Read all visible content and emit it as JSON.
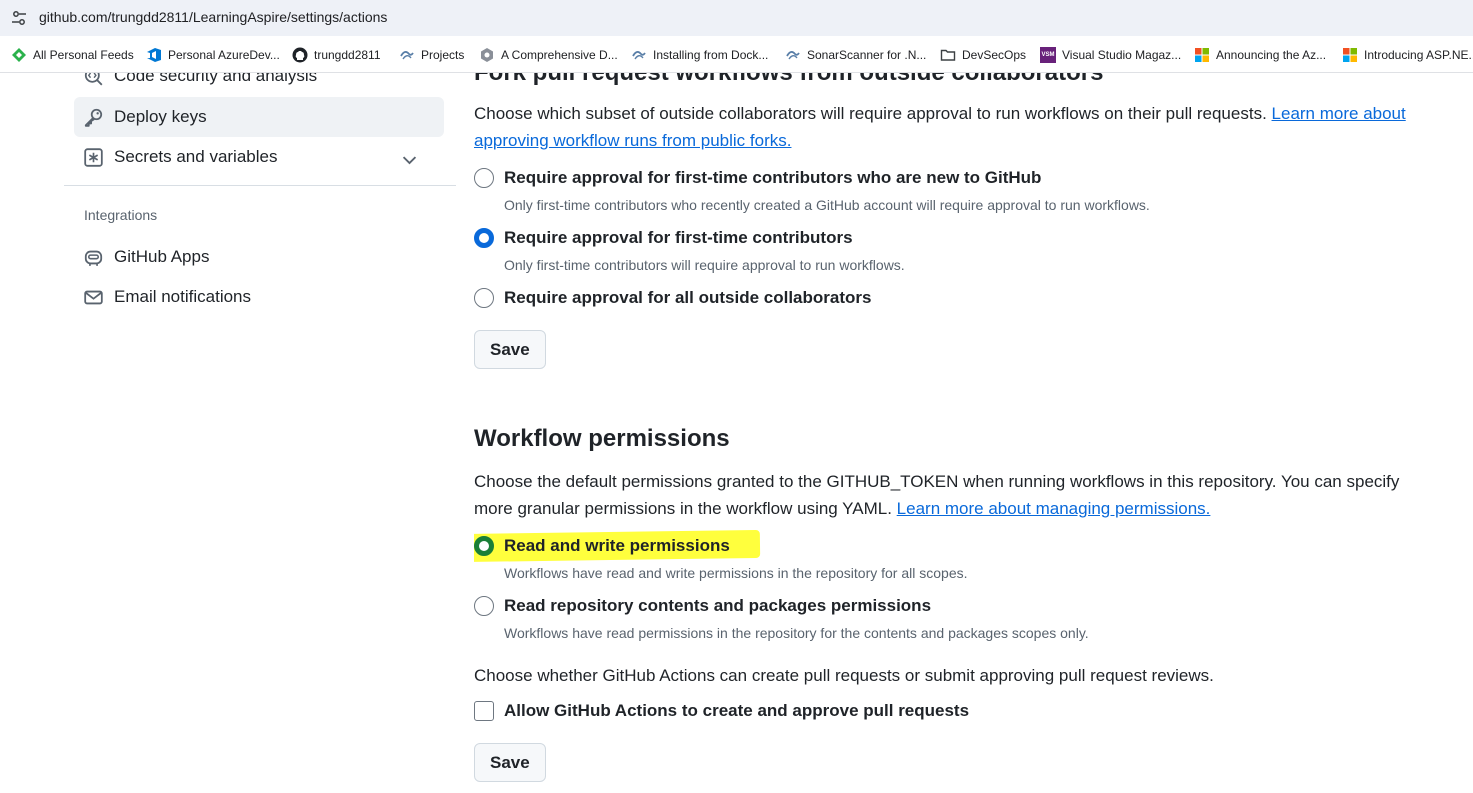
{
  "browser": {
    "url": "github.com/trungdd2811/LearningAspire/settings/actions",
    "bookmarks": [
      {
        "label": "All Personal Feeds",
        "icon": "feedly-icon"
      },
      {
        "label": "Personal AzureDev...",
        "icon": "azure-devops-icon"
      },
      {
        "label": "trungdd2811",
        "icon": "github-icon"
      },
      {
        "label": "Projects",
        "icon": "tilde-icon"
      },
      {
        "label": "A Comprehensive D...",
        "icon": "hexagon-icon"
      },
      {
        "label": "Installing from Dock...",
        "icon": "tilde-icon"
      },
      {
        "label": "SonarScanner for .N...",
        "icon": "tilde-icon"
      },
      {
        "label": "DevSecOps",
        "icon": "folder-icon"
      },
      {
        "label": "Visual Studio Magaz...",
        "icon": "vsm-icon",
        "badge": "VSM"
      },
      {
        "label": "Announcing the Az...",
        "icon": "microsoft-icon"
      },
      {
        "label": "Introducing ASP.NE...",
        "icon": "microsoft-icon"
      }
    ]
  },
  "sidebar": {
    "items": [
      {
        "label": "Code security and analysis",
        "icon": "codescan-icon",
        "active": false
      },
      {
        "label": "Deploy keys",
        "icon": "key-icon",
        "active": true
      },
      {
        "label": "Secrets and variables",
        "icon": "asterisk-icon",
        "active": false,
        "expandable": true
      }
    ],
    "integrations_heading": "Integrations",
    "integrations": [
      {
        "label": "GitHub Apps",
        "icon": "hubot-icon"
      },
      {
        "label": "Email notifications",
        "icon": "mail-icon"
      }
    ]
  },
  "fork_section": {
    "title": "Fork pull request workflows from outside collaborators",
    "description": "Choose which subset of outside collaborators will require approval to run workflows on their pull requests.",
    "learn_more_link": "Learn more about approving workflow runs from public forks.",
    "options": [
      {
        "label": "Require approval for first-time contributors who are new to GitHub",
        "description": "Only first-time contributors who recently created a GitHub account will require approval to run workflows.",
        "checked": false
      },
      {
        "label": "Require approval for first-time contributors",
        "description": "Only first-time contributors will require approval to run workflows.",
        "checked": true
      },
      {
        "label": "Require approval for all outside collaborators",
        "description": "",
        "checked": false
      }
    ],
    "save_label": "Save"
  },
  "workflow_permissions": {
    "title": "Workflow permissions",
    "description": "Choose the default permissions granted to the GITHUB_TOKEN when running workflows in this repository. You can specify more granular permissions in the workflow using YAML.",
    "learn_more_link": "Learn more about managing permissions.",
    "options": [
      {
        "label": "Read and write permissions",
        "description": "Workflows have read and write permissions in the repository for all scopes.",
        "checked": true,
        "highlighted": true
      },
      {
        "label": "Read repository contents and packages permissions",
        "description": "Workflows have read permissions in the repository for the contents and packages scopes only.",
        "checked": false
      }
    ],
    "pr_description": "Choose whether GitHub Actions can create pull requests or submit approving pull request reviews.",
    "pr_checkbox_label": "Allow GitHub Actions to create and approve pull requests",
    "pr_checkbox_checked": false,
    "save_label": "Save"
  },
  "colors": {
    "link": "#0969da",
    "radio_checked": "#0969da",
    "highlight": "#ffff3d",
    "highlighted_radio": "#1a7f37",
    "active_sidebar_bg": "#eff2f5"
  }
}
